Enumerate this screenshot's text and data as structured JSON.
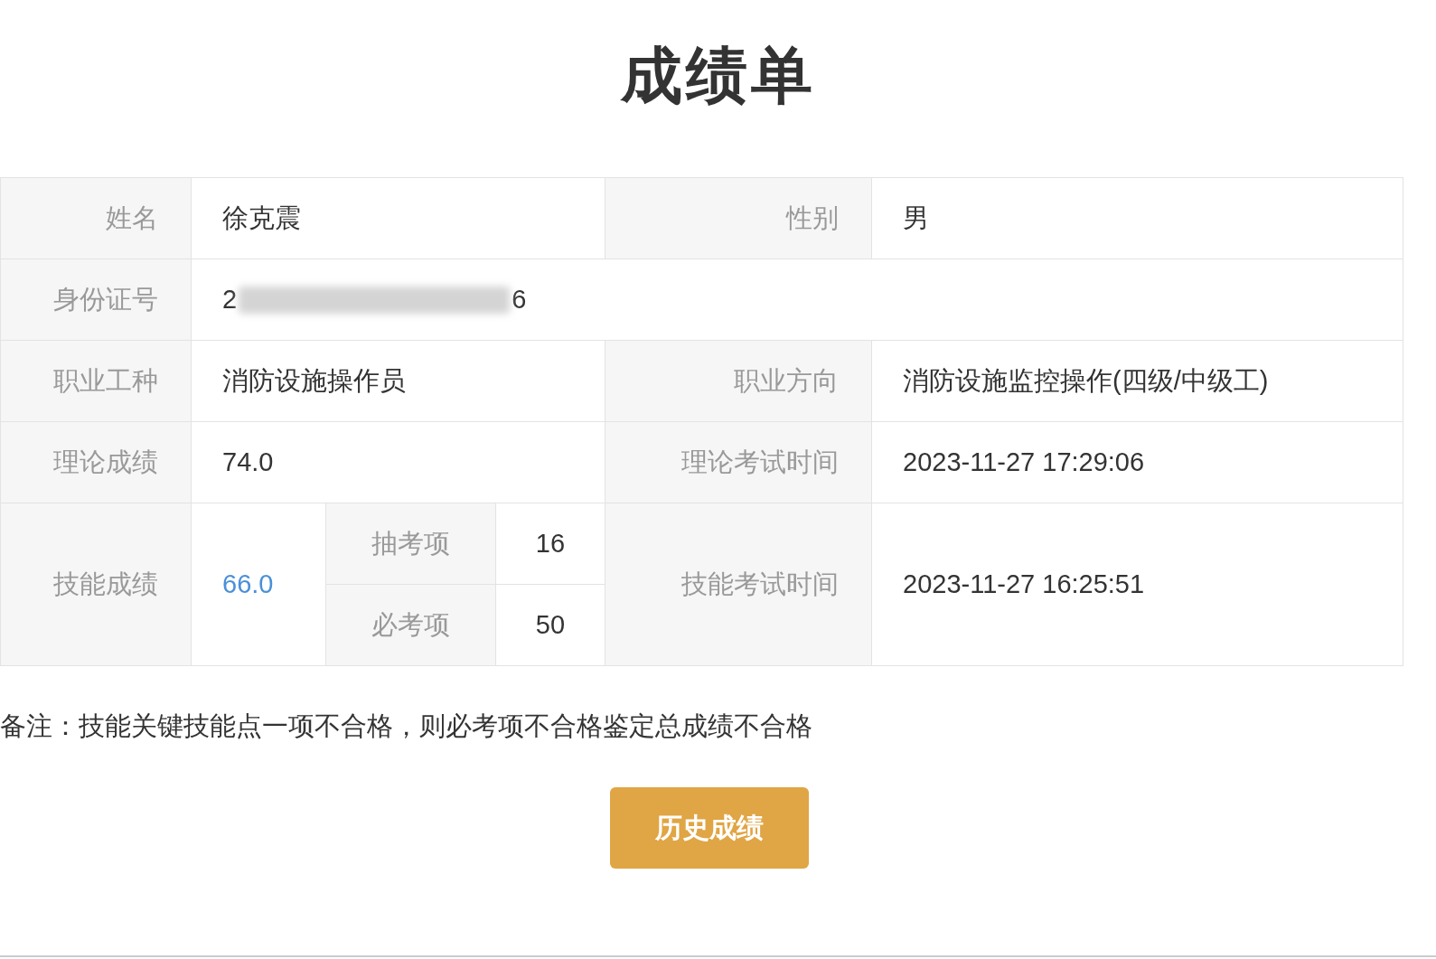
{
  "title": "成绩单",
  "info": {
    "name_label": "姓名",
    "name": "徐克震",
    "gender_label": "性别",
    "gender": "男",
    "id_label": "身份证号",
    "id_start": "2",
    "id_end": "6",
    "occupation_label": "职业工种",
    "occupation": "消防设施操作员",
    "direction_label": "职业方向",
    "direction": "消防设施监控操作(四级/中级工)",
    "theory_label": "理论成绩",
    "theory_score": "74.0",
    "theory_time_label": "理论考试时间",
    "theory_time": "2023-11-27 17:29:06",
    "skill_label": "技能成绩",
    "skill_score": "66.0",
    "skill_items": [
      {
        "label": "抽考项",
        "value": "16"
      },
      {
        "label": "必考项",
        "value": "50"
      }
    ],
    "skill_time_label": "技能考试时间",
    "skill_time": "2023-11-27 16:25:51"
  },
  "note": "备注：技能关键技能点一项不合格，则必考项不合格鉴定总成绩不合格",
  "button": "历史成绩"
}
